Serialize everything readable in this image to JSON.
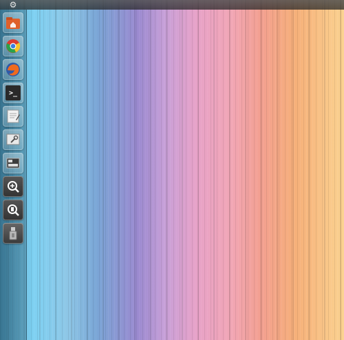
{
  "top_panel": {
    "menu_icon": "gear-icon"
  },
  "launcher": {
    "items": [
      {
        "name": "home-folder",
        "icon": "folder-home-icon",
        "color": "#e0602a"
      },
      {
        "name": "chrome",
        "icon": "chrome-icon",
        "color": "#d33"
      },
      {
        "name": "firefox",
        "icon": "firefox-icon",
        "color": "#e8751a"
      },
      {
        "name": "terminal",
        "icon": "terminal-icon",
        "glyph": ">_"
      },
      {
        "name": "text-editor",
        "icon": "text-editor-icon"
      },
      {
        "name": "system-settings",
        "icon": "settings-icon"
      },
      {
        "name": "workspace-switcher",
        "icon": "workspace-icon"
      },
      {
        "name": "dash-search",
        "icon": "search-plus-icon"
      },
      {
        "name": "files-search",
        "icon": "search-file-icon"
      },
      {
        "name": "usb-drive",
        "icon": "usb-icon"
      }
    ]
  },
  "colors": {
    "launcher_bg": "#2f5e72",
    "panel_bg": "#3a3a3a"
  }
}
